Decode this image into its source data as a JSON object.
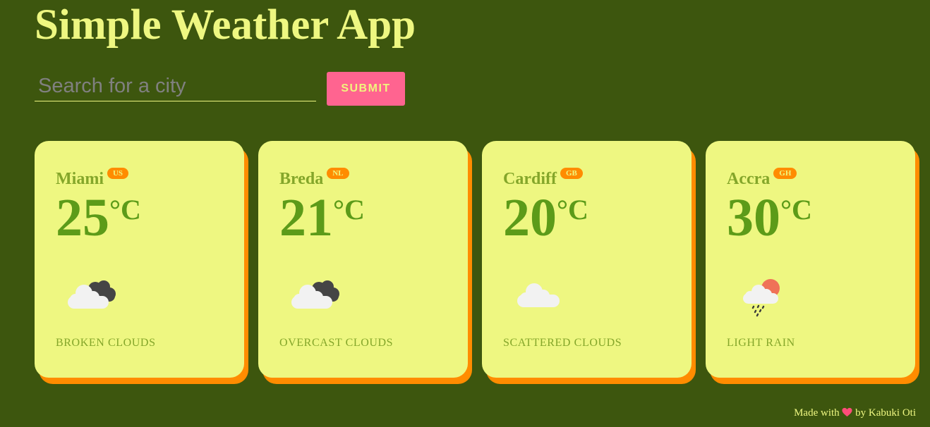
{
  "app": {
    "title": "Simple Weather App"
  },
  "search": {
    "placeholder": "Search for a city",
    "value": "",
    "submit_label": "SUBMIT"
  },
  "cities": [
    {
      "name": "Miami",
      "country": "US",
      "temp": "25",
      "unit": "°C",
      "description": "broken clouds",
      "icon": "broken-clouds-icon"
    },
    {
      "name": "Breda",
      "country": "NL",
      "temp": "21",
      "unit": "°C",
      "description": "overcast clouds",
      "icon": "overcast-clouds-icon"
    },
    {
      "name": "Cardiff",
      "country": "GB",
      "temp": "20",
      "unit": "°C",
      "description": "scattered clouds",
      "icon": "scattered-clouds-icon"
    },
    {
      "name": "Accra",
      "country": "GH",
      "temp": "30",
      "unit": "°C",
      "description": "light rain",
      "icon": "light-rain-icon"
    }
  ],
  "footer": {
    "made_with": "Made with",
    "by": "by Kabuki Oti",
    "icon": "heart-icon"
  },
  "colors": {
    "background": "#3d560e",
    "accent": "#eef781",
    "card_shadow": "#ff8c00",
    "submit_button": "#ff6490",
    "temperature": "#5c9b19",
    "heart": "#ff4d7a"
  }
}
